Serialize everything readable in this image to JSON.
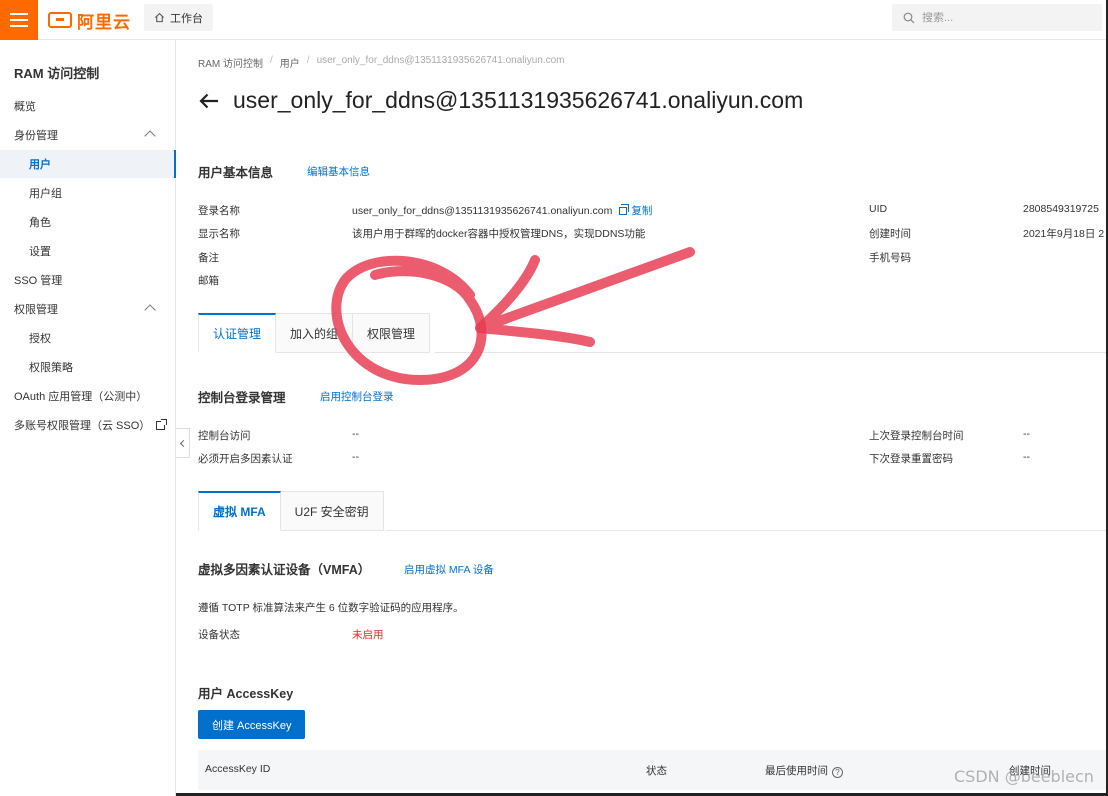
{
  "topbar": {
    "logo": "阿里云",
    "workbench": "工作台",
    "search_placeholder": "搜索..."
  },
  "sidebar": {
    "title": "RAM 访问控制",
    "items": [
      {
        "label": "概览"
      },
      {
        "label": "身份管理"
      },
      {
        "label": "用户"
      },
      {
        "label": "用户组"
      },
      {
        "label": "角色"
      },
      {
        "label": "设置"
      },
      {
        "label": "SSO 管理"
      },
      {
        "label": "权限管理"
      },
      {
        "label": "授权"
      },
      {
        "label": "权限策略"
      },
      {
        "label": "OAuth 应用管理（公测中）"
      },
      {
        "label": "多账号权限管理（云 SSO）"
      }
    ]
  },
  "breadcrumb": {
    "items": [
      "RAM 访问控制",
      "用户",
      "user_only_for_ddns@1351131935626741.onaliyun.com"
    ]
  },
  "page": {
    "title": "user_only_for_ddns@1351131935626741.onaliyun.com"
  },
  "basic_info": {
    "title": "用户基本信息",
    "edit_link": "编辑基本信息",
    "login_name_label": "登录名称",
    "login_name_value": "user_only_for_ddns@1351131935626741.onaliyun.com",
    "copy_label": "复制",
    "display_name_label": "显示名称",
    "display_name_value": "该用户用于群晖的docker容器中授权管理DNS，实现DDNS功能",
    "remark_label": "备注",
    "email_label": "邮箱",
    "uid_label": "UID",
    "uid_value": "2808549319725",
    "created_label": "创建时间",
    "created_value": "2021年9月18日 2",
    "phone_label": "手机号码"
  },
  "tabs": [
    "认证管理",
    "加入的组",
    "权限管理"
  ],
  "console_login": {
    "title": "控制台登录管理",
    "enable_link": "启用控制台登录",
    "access_label": "控制台访问",
    "access_value": "--",
    "mfa_label": "必须开启多因素认证",
    "mfa_value": "--",
    "last_login_label": "上次登录控制台时间",
    "last_login_value": "--",
    "next_reset_label": "下次登录重置密码",
    "next_reset_value": "--"
  },
  "mfa_tabs": [
    "虚拟 MFA",
    "U2F 安全密钥"
  ],
  "vmfa": {
    "title": "虚拟多因素认证设备（VMFA）",
    "enable_link": "启用虚拟 MFA 设备",
    "desc": "遵循 TOTP 标准算法来产生 6 位数字验证码的应用程序。",
    "status_label": "设备状态",
    "status_value": "未启用"
  },
  "accesskey": {
    "title": "用户 AccessKey",
    "create_button": "创建 AccessKey",
    "columns": [
      "AccessKey ID",
      "状态",
      "最后使用时间",
      "创建时间"
    ],
    "help_icon_glyph": "?"
  },
  "watermark": "CSDN @beeblecn",
  "colors": {
    "brand": "#ff6a00",
    "link": "#0070cc",
    "danger": "#d93026",
    "annotation": "#e8384f"
  }
}
